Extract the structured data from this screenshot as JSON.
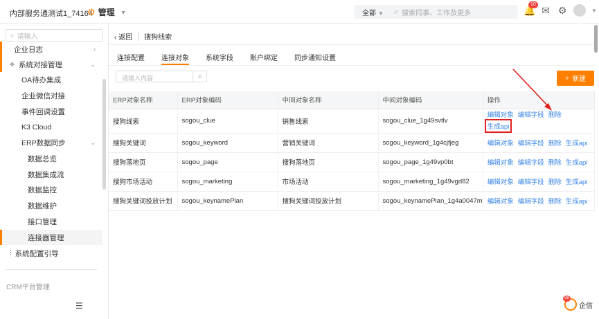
{
  "topbar": {
    "org": "内部服务通测试1_74164",
    "manage": "管理",
    "search_scope": "全部",
    "search_placeholder": "搜索同事、工作及更多",
    "notification_badge": "10"
  },
  "sidebar": {
    "search_placeholder": "请输入",
    "items": [
      {
        "label": "企业日志"
      },
      {
        "label": "系统对接管理"
      },
      {
        "label": "OA待办集成"
      },
      {
        "label": "企业微信对接"
      },
      {
        "label": "事件回调设置"
      },
      {
        "label": "K3 Cloud"
      },
      {
        "label": "ERP数据同步"
      },
      {
        "label": "数据总览"
      },
      {
        "label": "数据集成流"
      },
      {
        "label": "数据监控"
      },
      {
        "label": "数据维护"
      },
      {
        "label": "接口管理"
      },
      {
        "label": "连接器管理"
      },
      {
        "label": "系统配置引导"
      }
    ],
    "crm": "CRM平台管理"
  },
  "main": {
    "back": "返回",
    "title": "搜狗线索",
    "tabs": [
      "连接配置",
      "连接对象",
      "系统字段",
      "账户绑定",
      "同步通知设置"
    ],
    "filter_placeholder": "请输入内容",
    "new_label": "新建",
    "columns": [
      "ERP对象名称",
      "ERP对象编码",
      "中间对象名称",
      "中间对象编码",
      "操作"
    ],
    "rows": [
      [
        "搜狗线索",
        "sogou_clue",
        "销售线索",
        "sogou_clue_1g49svtlv"
      ],
      [
        "搜狗关键词",
        "sogou_keyword",
        "营销关键词",
        "sogou_keyword_1g4cjfjeg"
      ],
      [
        "搜狗落地页",
        "sogou_page",
        "搜狗落地页",
        "sogou_page_1g49vp0bt"
      ],
      [
        "搜狗市场活动",
        "sogou_marketing",
        "市场活动",
        "sogou_marketing_1g49vgd82"
      ],
      [
        "搜狗关键词投放计划",
        "sogou_keynamePlan",
        "搜狗关键词投放计划",
        "sogou_keynamePlan_1g4a0047m"
      ]
    ],
    "ops": [
      "编辑对象",
      "编辑字段",
      "删除",
      "生成api"
    ]
  },
  "footer": {
    "qixin_label": "企信",
    "qixin_badge": "98"
  },
  "colors": {
    "accent": "#ff8000",
    "link": "#3a86e8",
    "highlight": "#e02020"
  }
}
